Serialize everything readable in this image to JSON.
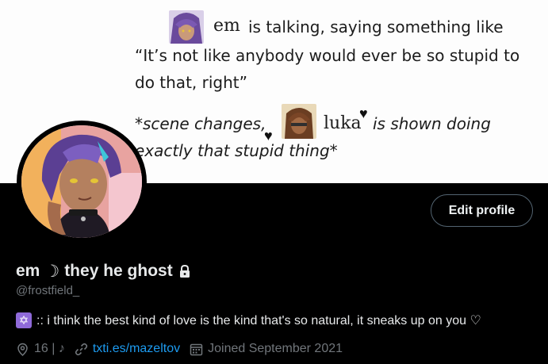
{
  "banner": {
    "name_em": "em",
    "line1_rest": "is talking, saying something like",
    "line2": "“It’s not like anybody would ever be so stupid to",
    "line3": "do that, right”",
    "line4_pre": "*scene changes,",
    "name_luka": "luka",
    "line4_post": "is shown doing",
    "line5": "exactly that stupid thing*"
  },
  "profile": {
    "edit_button": "Edit profile",
    "display_name": "em",
    "moon": "☽",
    "display_name_rest": "they he ghost",
    "handle": "@frostfield_",
    "bio": ":: i think the best kind of love is the kind that's so natural, it sneaks up on you ♡",
    "bio_badge": "✡",
    "location": "16 | ♪",
    "website": "txti.es/mazeltov",
    "joined": "Joined September 2021"
  },
  "colors": {
    "background": "#000000",
    "text_primary": "#e7e9ea",
    "text_secondary": "#71767b",
    "link": "#1d9bf0",
    "button_border": "#536471",
    "bio_badge": "#8f6ad9"
  },
  "icons": [
    "lock-icon",
    "location-icon",
    "link-icon",
    "calendar-icon",
    "star-of-david-icon",
    "heart-icon"
  ]
}
